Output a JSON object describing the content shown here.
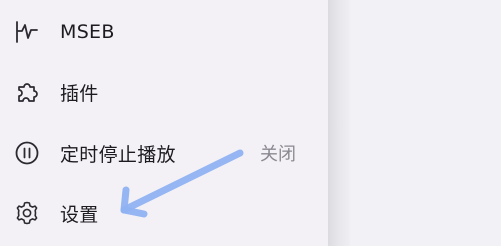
{
  "menu": {
    "items": [
      {
        "icon": "waveform-icon",
        "label": "MSEB",
        "value": ""
      },
      {
        "icon": "puzzle-icon",
        "label": "插件",
        "value": ""
      },
      {
        "icon": "timer-stop-icon",
        "label": "定时停止播放",
        "value": "关闭"
      },
      {
        "icon": "gear-icon",
        "label": "设置",
        "value": ""
      }
    ]
  },
  "colors": {
    "drawer_background": "#f3f1f6",
    "accent": "#ffc300",
    "annotation_arrow": "#8fb2f2",
    "icon": "#2b2a30"
  }
}
